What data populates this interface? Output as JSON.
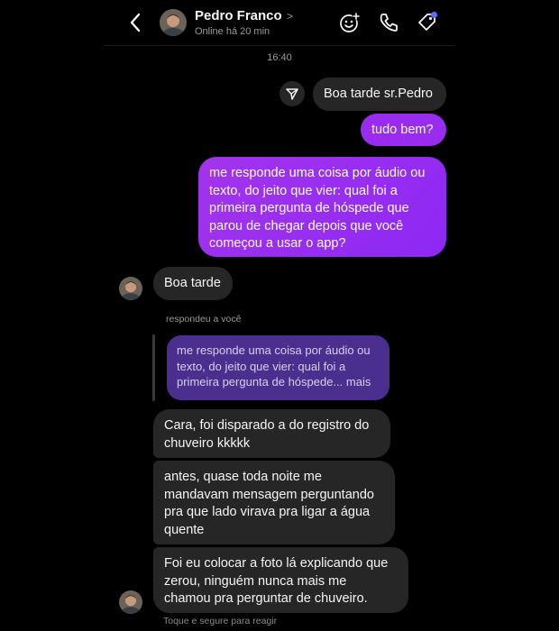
{
  "header": {
    "contact_name": "Pedro Franco",
    "name_chevron": ">",
    "status": "Online há 20 min"
  },
  "conversation": {
    "timestamp": "16:40",
    "outgoing": [
      "Boa tarde sr.Pedro",
      "tudo bem?",
      "me responde uma coisa por áudio ou\ntexto, do jeito que vier: qual foi a\nprimeira pergunta de hóspede que\nparou de chegar depois que você\ncomeçou a usar o app?"
    ],
    "incoming_first": "Boa tarde",
    "reply": {
      "label": "respondeu a você",
      "quoted_text": "me responde uma coisa por áudio ou\ntexto, do jeito que vier: qual foi a\nprimeira pergunta de hóspede... mais"
    },
    "incoming": [
      "Cara, foi disparado a do registro do\nchuveiro kkkkk",
      "antes, quase toda noite me\nmandavam mensagem perguntando\npra que lado virava pra ligar a água\nquente",
      "Foi eu colocar a foto lá explicando que\nzerou, ninguém nunca mais me\nchamou pra perguntar de chuveiro."
    ],
    "react_hint": "Toque e segure para reagir"
  },
  "colors": {
    "background": "#000000",
    "bubble_gray": "#262626",
    "bubble_purple": "#9a2cf0",
    "quote_purple": "#4a2f8e",
    "badge_blue": "#5b6cff"
  },
  "icons": [
    "back-icon",
    "add-reaction-icon",
    "phone-icon",
    "tag-icon",
    "send-icon"
  ]
}
